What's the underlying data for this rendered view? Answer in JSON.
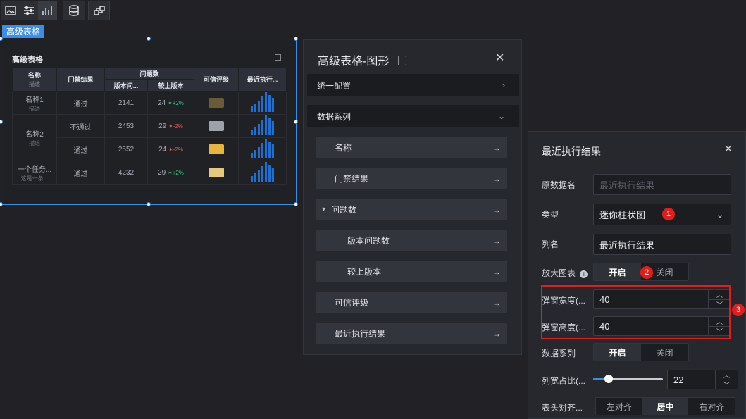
{
  "canvas": {
    "tag": "高级表格",
    "component_title": "高级表格",
    "table": {
      "headers": {
        "name": "名称",
        "name_sub": "描述",
        "access": "门禁结果",
        "issues": "问题数",
        "issues_version": "版本问...",
        "issues_prev": "较上版本",
        "rating": "可信评级",
        "recent": "最近执行..."
      },
      "rows": [
        {
          "name": "名称1",
          "desc": "描述",
          "access": "通过",
          "version": "2141",
          "prev": "24",
          "trend": "+2%",
          "dir": "up"
        },
        {
          "name": "名称2",
          "desc": "描述",
          "access": "不通过",
          "version": "2453",
          "prev": "29",
          "trend": "-2%",
          "dir": "down"
        },
        {
          "name": "",
          "desc": "",
          "access": "通过",
          "version": "2552",
          "prev": "24",
          "trend": "-2%",
          "dir": "down"
        },
        {
          "name": "一个任务...",
          "desc": "这是一条...",
          "access": "通过",
          "version": "4232",
          "prev": "29",
          "trend": "+2%",
          "dir": "up"
        }
      ]
    }
  },
  "panel_mid": {
    "title": "高级表格-图形",
    "close": "✕",
    "unified": "统一配置",
    "series_section": "数据系列",
    "items": [
      {
        "label": "名称"
      },
      {
        "label": "门禁结果"
      },
      {
        "label": "问题数",
        "caret": "▾"
      },
      {
        "label": "版本问题数"
      },
      {
        "label": "较上版本"
      },
      {
        "label": "可信评级"
      },
      {
        "label": "最近执行结果"
      }
    ]
  },
  "panel_right": {
    "title": "最近执行结果",
    "close": "✕",
    "source_label": "原数据名",
    "source_placeholder": "最近执行结果",
    "type_label": "类型",
    "type_value": "迷你柱状图",
    "colname_label": "列名",
    "colname_value": "最近执行结果",
    "zoom_label": "放大图表",
    "zoom_on": "开启",
    "zoom_off": "关闭",
    "popup_width_label": "弹窗宽度(...",
    "popup_width_value": "40",
    "popup_height_label": "弹窗高度(...",
    "popup_height_value": "40",
    "series_label": "数据系列",
    "series_on": "开启",
    "series_off": "关闭",
    "colwidth_label": "列宽占比(...",
    "colwidth_value": "22",
    "colwidth_fraction": 0.2,
    "header_align_label": "表头对齐...",
    "align_left": "左对齐",
    "align_center": "居中",
    "align_right": "右对齐"
  },
  "markers": [
    "1",
    "2",
    "3"
  ]
}
